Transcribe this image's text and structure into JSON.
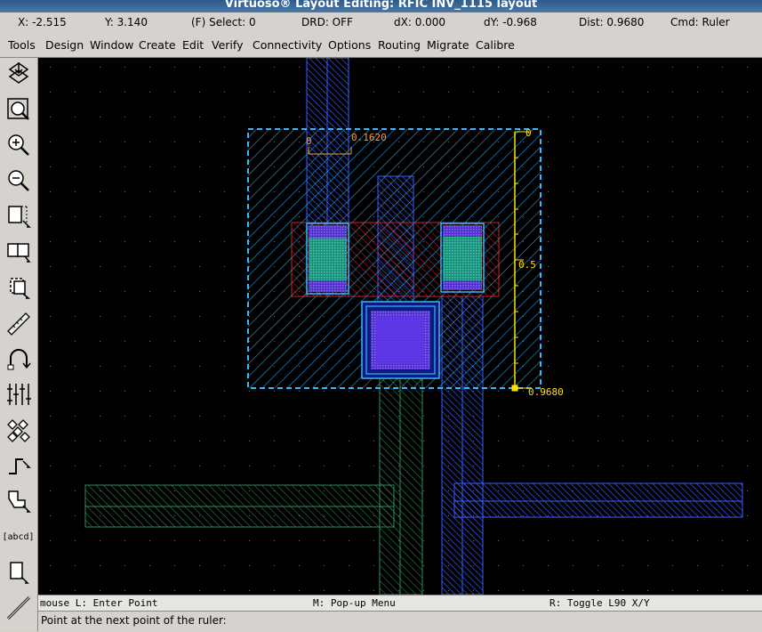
{
  "window": {
    "title": "Virtuoso® Layout Editing: RFIC INV_1115 layout"
  },
  "status": {
    "x": "X: -2.515",
    "y": "Y: 3.140",
    "select": "(F) Select: 0",
    "drd": "DRD: OFF",
    "dx": "dX: 0.000",
    "dy": "dY: -0.968",
    "dist": "Dist: 0.9680",
    "cmd": "Cmd: Ruler"
  },
  "menu": {
    "items": [
      "Tools",
      "Design",
      "Window",
      "Create",
      "Edit",
      "Verify",
      "Connectivity",
      "Options",
      "Routing",
      "Migrate",
      "Calibre"
    ]
  },
  "toolbar": {
    "label_tool_text": "[abcd]",
    "icons": [
      "save-icon",
      "fit-view-icon",
      "zoom-in-icon",
      "zoom-out-icon",
      "stretch-icon",
      "copy-icon",
      "move-icon",
      "ruler-icon",
      "undo-icon",
      "instance-icon",
      "properties-icon",
      "path-icon",
      "polygon-icon",
      "label-icon",
      "rectangle-icon",
      "wire-icon"
    ]
  },
  "canvas": {
    "ruler_labels": {
      "width": "0.1620",
      "zero": "0",
      "mid": "0.5",
      "end": "0.9680",
      "tick_zero": "0"
    },
    "colors": {
      "background": "#000000",
      "metal1": "#3a5cff",
      "poly": "#cc1f1f",
      "nwell": "#35b8ff",
      "diffusion": "#2fb39a",
      "metal2": "#2e8c5a",
      "ruler": "#ffe000",
      "ruler_label": "#ff9a2e"
    }
  },
  "bottom": {
    "mouse_left": "mouse L: Enter Point",
    "mouse_mid": "M: Pop-up Menu",
    "mouse_right": "R: Toggle L90 X/Y",
    "prompt": "Point at the next point of the ruler:"
  }
}
